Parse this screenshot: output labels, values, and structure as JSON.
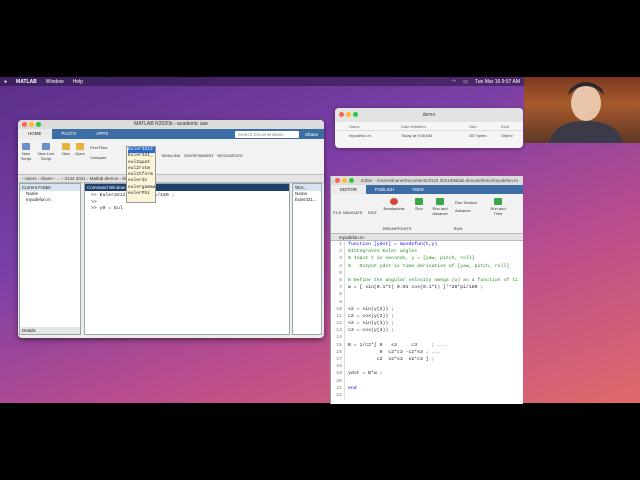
{
  "menubar": {
    "apple": "",
    "app": "MATLAB",
    "items": [
      "Window",
      "Help"
    ],
    "clock": "Tue Mar 16 9:57 AM"
  },
  "matlab": {
    "title": "MATLAB R2020b - academic use",
    "tabs": [
      "HOME",
      "PLOTS",
      "APPS"
    ],
    "search_placeholder": "Search Documentation",
    "user": "Shane",
    "ribbon": {
      "new_script": "New Script",
      "new_live_script": "New Live Script",
      "new": "New",
      "open": "Open",
      "find_files": "Find Files",
      "compare": "Compare",
      "simulink": "SIMULINK",
      "environment": "ENVIRONMENT",
      "resources": "RESOURCES"
    },
    "address": "› Users › shane › ... › 3144 2021 › Matlab demos › demo",
    "current_folder": {
      "title": "Current Folder",
      "header": "Name",
      "file": "myodefun.m",
      "details": "Details"
    },
    "command_window": {
      "title": "Command Window",
      "line1": ">> Euler3212 ... [0]*pi/180 ;",
      "line2": ">>",
      "line3": ">> y0 = Eul"
    },
    "workspace": {
      "title": "Wor...",
      "header": "Name",
      "item": "Euler321..."
    },
    "autocomplete": [
      "Euler3212",
      "Euler321_",
      "eul2quat",
      "eul2rotm",
      "eul2tform",
      "eulerdc",
      "eulergamma",
      "eulerPhi"
    ]
  },
  "finder": {
    "title": "demo",
    "columns": [
      "Name",
      "Date Modified",
      "Size",
      "Kind"
    ],
    "row": [
      "myodefun.m",
      "Today at 9:08 AM",
      "457 bytes",
      "Object"
    ]
  },
  "editor": {
    "title": "Editor - /Users/shane/Documents/3144 2021/Matlab demos/demo/myodefun.m",
    "tabs": [
      "EDITOR",
      "PUBLISH",
      "VIEW"
    ],
    "ribbon": {
      "file": "FILE",
      "navigate": "NAVIGATE",
      "edit": "EDIT",
      "breakpoints": "Breakpoints",
      "breakpoints_label": "BREAKPOINTS",
      "run": "Run",
      "run_advance": "Run and Advance",
      "run_section": "Run Section",
      "advance": "Advance",
      "run_time": "Run and Time",
      "run_label": "RUN"
    },
    "file_tab": "myodefun.m",
    "code": [
      {
        "n": "1",
        "t": "function [ydot] = myodefun(t,y)",
        "c": "kw"
      },
      {
        "n": "2",
        "t": "%Integrates Euler angles",
        "c": "cm"
      },
      {
        "n": "3",
        "t": "% Input t is seconds, y = [yaw, pitch, roll]",
        "c": "cm"
      },
      {
        "n": "4",
        "t": "%   Output ydot is time derivative of [yaw, pitch, roll]",
        "c": "cm"
      },
      {
        "n": "5",
        "t": "",
        "c": ""
      },
      {
        "n": "6",
        "t": "% Define the angular velocity omega (w) as a function of ti",
        "c": "cm"
      },
      {
        "n": "7",
        "t": "w = [ sin(0.1*t) 0.01 cos(0.1*t) ]'*20*pi/180 ;",
        "c": ""
      },
      {
        "n": "8",
        "t": "",
        "c": ""
      },
      {
        "n": "9",
        "t": "",
        "c": ""
      },
      {
        "n": "10",
        "t": "s2 = sin(y(2)) ;",
        "c": ""
      },
      {
        "n": "11",
        "t": "c2 = cos(y(2)) ;",
        "c": ""
      },
      {
        "n": "12",
        "t": "s3 = sin(y(3)) ;",
        "c": ""
      },
      {
        "n": "13",
        "t": "c3 = cos(y(3)) ;",
        "c": ""
      },
      {
        "n": "14",
        "t": "",
        "c": ""
      },
      {
        "n": "15",
        "t": "B = 1/c2*[ 0   s3     c3     ; ...",
        "c": ""
      },
      {
        "n": "16",
        "t": "           0  c2*c3 -c2*s3 ; ...",
        "c": ""
      },
      {
        "n": "17",
        "t": "          c2  s2*s3  s2*c3 ] ;",
        "c": ""
      },
      {
        "n": "18",
        "t": "",
        "c": ""
      },
      {
        "n": "19",
        "t": "ydot = B*w ;",
        "c": ""
      },
      {
        "n": "20",
        "t": "",
        "c": ""
      },
      {
        "n": "21",
        "t": "end",
        "c": "kw"
      },
      {
        "n": "22",
        "t": "",
        "c": ""
      }
    ]
  }
}
